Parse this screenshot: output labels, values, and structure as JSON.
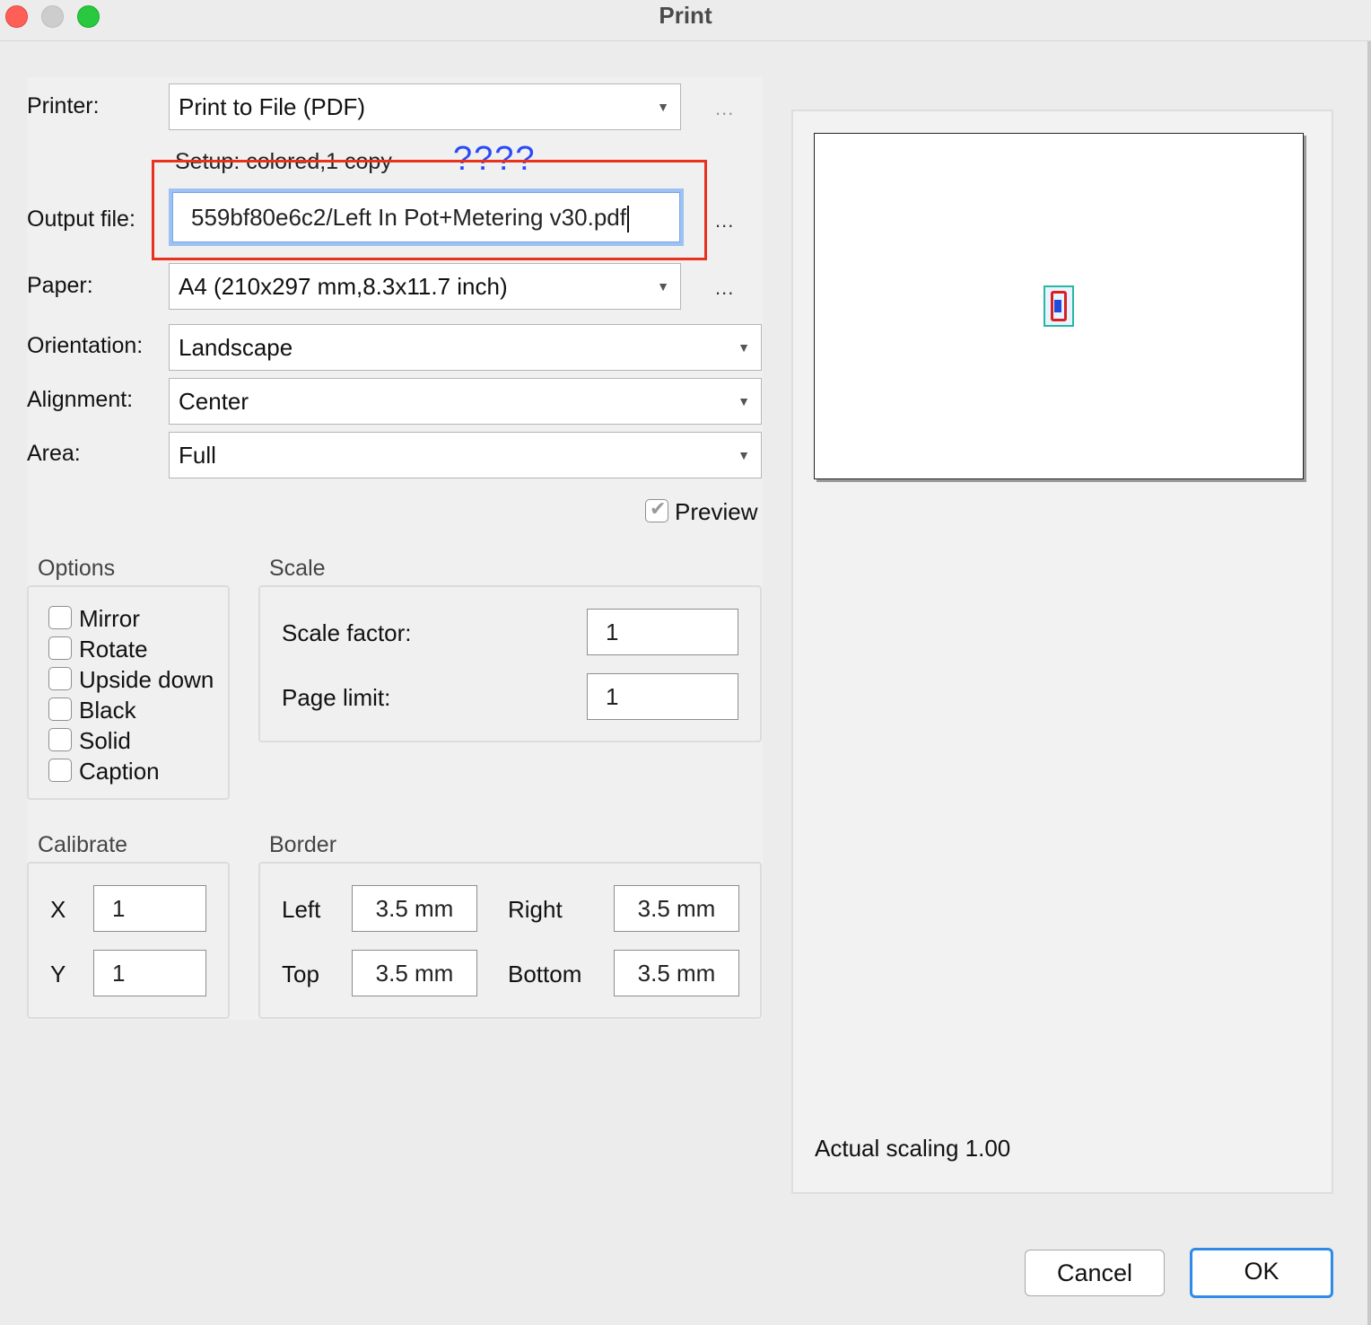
{
  "window": {
    "title": "Print"
  },
  "printer": {
    "label": "Printer:",
    "value": "Print to File (PDF)",
    "more": "..."
  },
  "setup": {
    "text": "Setup: colored,1 copy",
    "annotation": "????"
  },
  "output": {
    "label": "Output file:",
    "value": "559bf80e6c2/Left In Pot+Metering v30.pdf",
    "more": "..."
  },
  "paper": {
    "label": "Paper:",
    "value": "A4 (210x297 mm,8.3x11.7 inch)",
    "more": "..."
  },
  "orientation": {
    "label": "Orientation:",
    "value": "Landscape"
  },
  "alignment": {
    "label": "Alignment:",
    "value": "Center"
  },
  "area": {
    "label": "Area:",
    "value": "Full"
  },
  "preview": {
    "label": "Preview",
    "checked": true
  },
  "options": {
    "title": "Options",
    "items": [
      {
        "label": "Mirror",
        "checked": false
      },
      {
        "label": "Rotate",
        "checked": false
      },
      {
        "label": "Upside down",
        "checked": false
      },
      {
        "label": "Black",
        "checked": false
      },
      {
        "label": "Solid",
        "checked": false
      },
      {
        "label": "Caption",
        "checked": false
      }
    ]
  },
  "scale": {
    "title": "Scale",
    "factor_label": "Scale factor:",
    "factor_value": "1",
    "limit_label": "Page limit:",
    "limit_value": "1"
  },
  "calibrate": {
    "title": "Calibrate",
    "x_label": "X",
    "x_value": "1",
    "y_label": "Y",
    "y_value": "1"
  },
  "border": {
    "title": "Border",
    "left_label": "Left",
    "left_value": "3.5 mm",
    "right_label": "Right",
    "right_value": "3.5 mm",
    "top_label": "Top",
    "top_value": "3.5 mm",
    "bottom_label": "Bottom",
    "bottom_value": "3.5 mm"
  },
  "preview_panel": {
    "scaling_text": "Actual scaling 1.00"
  },
  "buttons": {
    "cancel": "Cancel",
    "ok": "OK"
  },
  "colors": {
    "highlight_box": "#e8321e",
    "annotation": "#2a4bf7",
    "focus_ring": "#9cc1f2",
    "default_button": "#2f8ae8"
  },
  "icons": {
    "dropdown": "triangle-down",
    "checkmark": "check"
  }
}
